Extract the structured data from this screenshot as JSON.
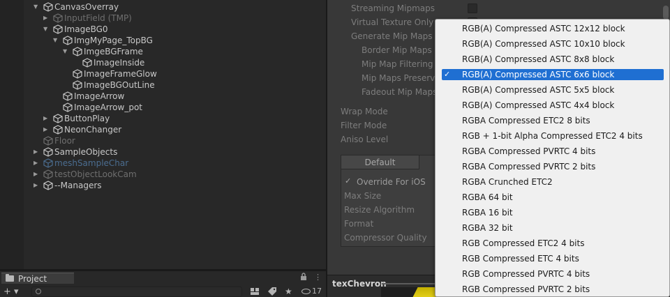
{
  "hierarchy": {
    "items": [
      {
        "label": "CanvasOverray",
        "depth": 0,
        "expanded": "open",
        "style": "normal"
      },
      {
        "label": "InputField (TMP)",
        "depth": 1,
        "expanded": "closed",
        "style": "dim"
      },
      {
        "label": "ImageBG0",
        "depth": 1,
        "expanded": "open",
        "style": "normal"
      },
      {
        "label": "ImgMyPage_TopBG",
        "depth": 2,
        "expanded": "open",
        "style": "normal"
      },
      {
        "label": "ImgeBGFrame",
        "depth": 3,
        "expanded": "open",
        "style": "normal"
      },
      {
        "label": "ImageInside",
        "depth": 4,
        "expanded": "none",
        "style": "normal"
      },
      {
        "label": "ImageFrameGlow",
        "depth": 3,
        "expanded": "none",
        "style": "normal"
      },
      {
        "label": "ImageBGOutLine",
        "depth": 3,
        "expanded": "none",
        "style": "normal"
      },
      {
        "label": "ImageArrow",
        "depth": 2,
        "expanded": "none",
        "style": "normal"
      },
      {
        "label": "ImageArrow_pot",
        "depth": 2,
        "expanded": "none",
        "style": "normal"
      },
      {
        "label": "ButtonPlay",
        "depth": 1,
        "expanded": "closed",
        "style": "normal"
      },
      {
        "label": "NeonChanger",
        "depth": 1,
        "expanded": "closed",
        "style": "normal"
      },
      {
        "label": "Floor",
        "depth": 0,
        "expanded": "none",
        "style": "dim"
      },
      {
        "label": "SampleObjects",
        "depth": 0,
        "expanded": "closed",
        "style": "normal"
      },
      {
        "label": "meshSampleChar",
        "depth": 0,
        "expanded": "closed",
        "style": "blue-dim"
      },
      {
        "label": "testObjectLookCam",
        "depth": 0,
        "expanded": "closed",
        "style": "dim"
      },
      {
        "label": "--Managers",
        "depth": 0,
        "expanded": "closed",
        "style": "normal"
      }
    ]
  },
  "project": {
    "tab_label": "Project",
    "visibility_count": "17"
  },
  "inspector": {
    "streaming_mipmaps": "Streaming Mipmaps",
    "virtual_texture_only": "Virtual Texture Only",
    "generate_mip_maps": "Generate Mip Maps",
    "border_mip_maps": "Border Mip Maps",
    "mip_map_filtering": "Mip Map Filtering",
    "mip_maps_preserve": "Mip Maps Preserve",
    "fadeout_mip_maps": "Fadeout Mip Maps",
    "wrap_mode": "Wrap Mode",
    "filter_mode": "Filter Mode",
    "aniso_level": "Aniso Level",
    "default_tab": "Default",
    "override_for_ios": "Override For iOS",
    "max_size": "Max Size",
    "resize_algorithm": "Resize Algorithm",
    "format": "Format",
    "compressor_quality": "Compressor Quality",
    "texture_name": "texChevron"
  },
  "dropdown": {
    "selected_index": 3,
    "options": [
      "RGB(A) Compressed ASTC 12x12 block",
      "RGB(A) Compressed ASTC 10x10 block",
      "RGB(A) Compressed ASTC 8x8 block",
      "RGB(A) Compressed ASTC 6x6 block",
      "RGB(A) Compressed ASTC 5x5 block",
      "RGB(A) Compressed ASTC 4x4 block",
      "RGBA Compressed ETC2 8 bits",
      "RGB + 1-bit Alpha Compressed ETC2 4 bits",
      "RGBA Compressed PVRTC 4 bits",
      "RGBA Compressed PVRTC 2 bits",
      "RGBA Crunched ETC2",
      "RGBA 64 bit",
      "RGBA 16 bit",
      "RGBA 32 bit",
      "RGB Compressed ETC2 4 bits",
      "RGB Compressed ETC 4 bits",
      "RGB Compressed PVRTC 4 bits",
      "RGB Compressed PVRTC 2 bits"
    ]
  },
  "colors": {
    "selection": "#1f6fd2",
    "panel": "#282828",
    "inspector": "#383838",
    "menu": "#f0f0f0"
  }
}
